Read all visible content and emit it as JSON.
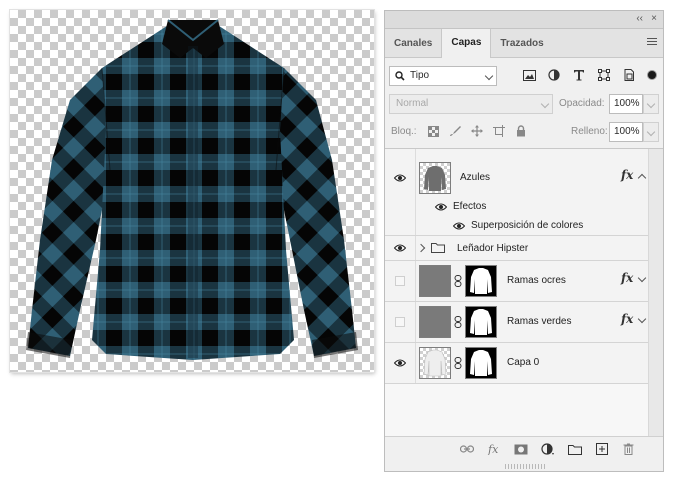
{
  "panel": {
    "collapse_label": "‹‹",
    "close_label": "×",
    "tabs": [
      {
        "label": "Canales",
        "active": false
      },
      {
        "label": "Capas",
        "active": true
      },
      {
        "label": "Trazados",
        "active": false
      }
    ],
    "filter": {
      "kind_label": "Tipo"
    },
    "blend_mode": {
      "value": "Normal"
    },
    "opacity": {
      "label": "Opacidad:",
      "value": "100%"
    },
    "lock": {
      "label": "Bloq.:"
    },
    "fill": {
      "label": "Relleno:",
      "value": "100%"
    },
    "layers": [
      {
        "name": "Azules",
        "visible": true,
        "fx": "fx",
        "effects_label": "Efectos",
        "effect": "Superposición de colores"
      },
      {
        "name": "Leñador Hipster",
        "visible": true,
        "type": "group"
      },
      {
        "name": "Ramas ocres",
        "visible": false,
        "fx": "fx"
      },
      {
        "name": "Ramas verdes",
        "visible": false,
        "fx": "fx"
      },
      {
        "name": "Capa 0",
        "visible": true
      }
    ]
  },
  "colors": {
    "shirt_blue": "#2f5f75",
    "shirt_dark": "#0b0b0b",
    "shirt_light": "#3f7892"
  },
  "icons": {
    "search": "search-icon",
    "eye": "eye-icon",
    "fx": "fx-icon",
    "folder": "folder-icon",
    "lock": "lock-icon",
    "trash": "trash-icon"
  }
}
